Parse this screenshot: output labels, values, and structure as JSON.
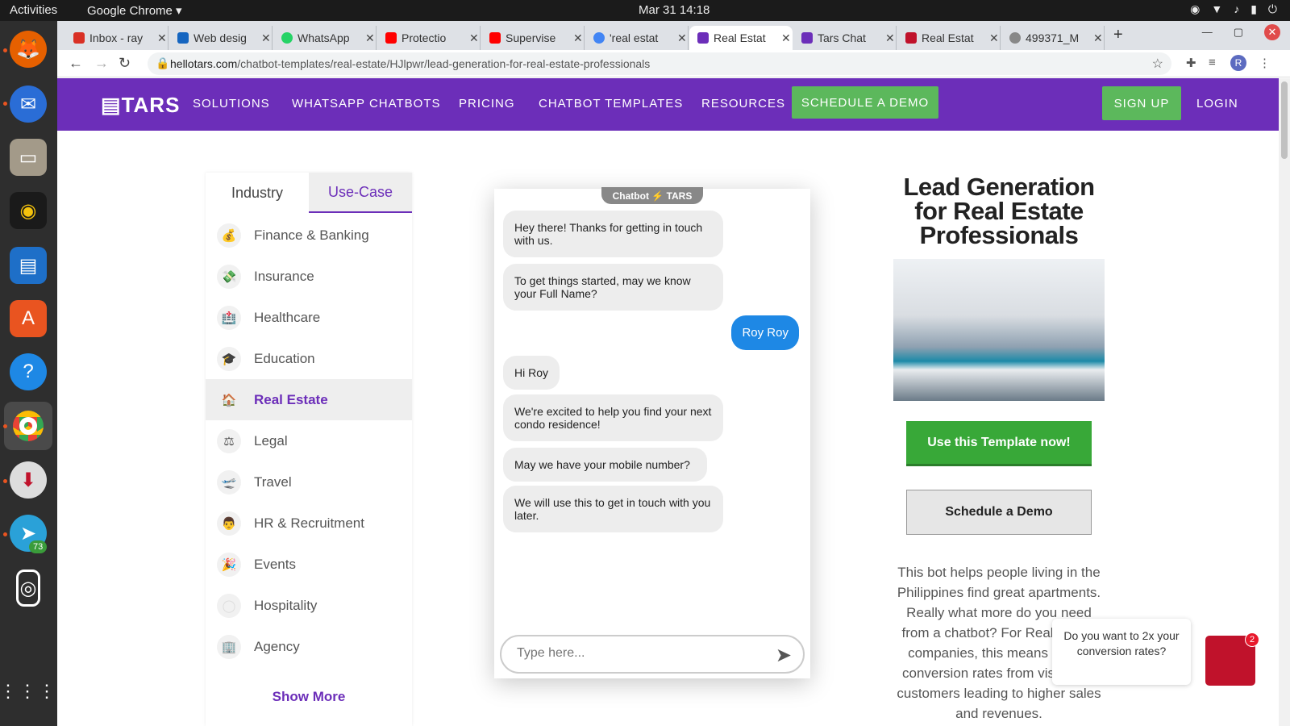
{
  "system": {
    "activities": "Activities",
    "app": "Google Chrome ▾",
    "clock": "Mar 31  14:18"
  },
  "dock": {
    "badge": "73"
  },
  "tabs": [
    {
      "title": "Inbox - ray",
      "color": "#d93025"
    },
    {
      "title": "Web desig",
      "color": "#1565c0"
    },
    {
      "title": "WhatsApp",
      "color": "#25d366"
    },
    {
      "title": "Protectio",
      "color": "#ff0000"
    },
    {
      "title": "Supervise",
      "color": "#ff0000"
    },
    {
      "title": "'real estat",
      "color": "#4285f4"
    },
    {
      "title": "Real Estat",
      "color": "#6c2eb9"
    },
    {
      "title": "Tars Chat",
      "color": "#6c2eb9"
    },
    {
      "title": "Real Estat",
      "color": "#c0122b"
    },
    {
      "title": "499371_M",
      "color": "#888888"
    }
  ],
  "url": {
    "domain": "hellotars.com",
    "path": "/chatbot-templates/real-estate/HJlpwr/lead-generation-for-real-estate-professionals"
  },
  "header": {
    "logo": "TARS",
    "menu": [
      "SOLUTIONS",
      "WHATSAPP CHATBOTS",
      "PRICING",
      "CHATBOT TEMPLATES",
      "RESOURCES"
    ],
    "demo": "SCHEDULE A DEMO",
    "signup": "SIGN UP",
    "login": "LOGIN"
  },
  "sidebar": {
    "tab_industry": "Industry",
    "tab_usecase": "Use-Case",
    "show_more": "Show More",
    "items": [
      {
        "label": "Finance & Banking",
        "icon": "💰"
      },
      {
        "label": "Insurance",
        "icon": "💸"
      },
      {
        "label": "Healthcare",
        "icon": "🏥"
      },
      {
        "label": "Education",
        "icon": "🎓"
      },
      {
        "label": "Real Estate",
        "icon": "🏠"
      },
      {
        "label": "Legal",
        "icon": "⚖"
      },
      {
        "label": "Travel",
        "icon": "🛫"
      },
      {
        "label": "HR & Recruitment",
        "icon": "👨"
      },
      {
        "label": "Events",
        "icon": "🎉"
      },
      {
        "label": "Hospitality",
        "icon": "◯"
      },
      {
        "label": "Agency",
        "icon": "🏢"
      }
    ]
  },
  "chat": {
    "tag": "Chatbot ⚡ TARS",
    "placeholder": "Type here...",
    "bot1": "Hey there! Thanks for getting in touch with us.",
    "bot2": "To get things started, may we know your Full Name?",
    "user": "Roy Roy",
    "bot3": "Hi Roy",
    "bot4": "We're excited to help you find your next condo residence!",
    "bot5": "May we have your mobile number?",
    "bot6": "We will use this to get in touch with you later."
  },
  "template": {
    "title": "Lead Generation for Real Estate Professionals",
    "use": "Use this Template now!",
    "schedule": "Schedule a Demo",
    "desc": "This bot helps people living in the Philippines find great apartments. Really what more do you need from a chatbot? For Real Estate companies, this means higher conversion rates from visitors to customers leading to higher sales and revenues."
  },
  "popup": {
    "text": "Do you want to 2x your conversion rates?",
    "badge": "2"
  }
}
